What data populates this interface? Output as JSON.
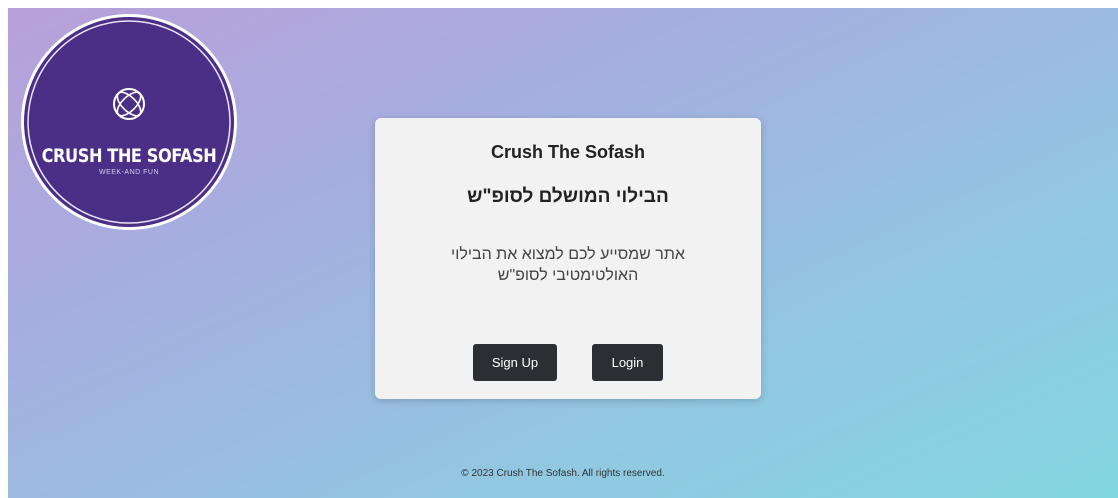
{
  "logo": {
    "title": "CRUSH THE SOFASH",
    "subtitle": "WEEK-AND FUN",
    "icon": "globe-knot-icon",
    "circle_color": "#4b2f86"
  },
  "card": {
    "title": "Crush The Sofash",
    "subtitle": "הבילוי המושלם לסופ\"ש",
    "description": "אתר שמסייע לכם למצוא את הבילוי האולטימטיבי לסופ\"ש",
    "signup_label": "Sign Up",
    "login_label": "Login"
  },
  "footer": {
    "text": "© 2023 Crush The Sofash. All rights reserved."
  }
}
